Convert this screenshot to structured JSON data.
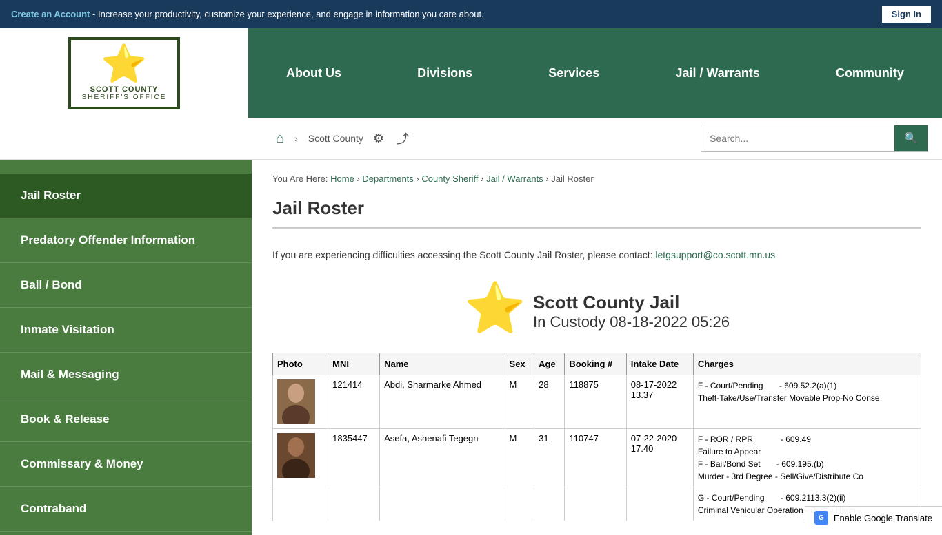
{
  "topBanner": {
    "createAccountText": "Create an Account",
    "bannerText": " - Increase your productivity, customize your experience, and engage in information you care about.",
    "signInLabel": "Sign In"
  },
  "nav": {
    "logoLine1": "SCOTT COUNTY",
    "logoLine2": "SHERIFF'S OFFICE",
    "links": [
      {
        "id": "about-us",
        "label": "About Us"
      },
      {
        "id": "divisions",
        "label": "Divisions"
      },
      {
        "id": "services",
        "label": "Services"
      },
      {
        "id": "jail-warrants",
        "label": "Jail / Warrants"
      },
      {
        "id": "community",
        "label": "Community"
      }
    ]
  },
  "secondaryNav": {
    "breadcrumbText": "Scott County",
    "searchPlaceholder": "Search..."
  },
  "sidebar": {
    "items": [
      {
        "id": "jail-roster",
        "label": "Jail Roster",
        "active": true
      },
      {
        "id": "predatory-offender",
        "label": "Predatory Offender Information"
      },
      {
        "id": "bail-bond",
        "label": "Bail / Bond"
      },
      {
        "id": "inmate-visitation",
        "label": "Inmate Visitation"
      },
      {
        "id": "mail-messaging",
        "label": "Mail & Messaging"
      },
      {
        "id": "book-release",
        "label": "Book & Release"
      },
      {
        "id": "commissary-money",
        "label": "Commissary & Money"
      },
      {
        "id": "contraband",
        "label": "Contraband"
      }
    ]
  },
  "breadcrumb": {
    "youAreHere": "You Are Here:",
    "items": [
      {
        "label": "Home",
        "href": "#"
      },
      {
        "label": "Departments",
        "href": "#"
      },
      {
        "label": "County Sheriff",
        "href": "#"
      },
      {
        "label": "Jail / Warrants",
        "href": "#"
      },
      {
        "label": "Jail Roster",
        "href": null
      }
    ]
  },
  "pageTitle": "Jail Roster",
  "infoText": "If you are experiencing difficulties accessing the Scott County Jail Roster, please contact:",
  "infoEmail": "letgsupport@co.scott.mn.us",
  "jailHeader": {
    "title": "Scott County Jail",
    "subtitle": "In Custody 08-18-2022 05:26"
  },
  "table": {
    "headers": [
      "Photo",
      "MNI",
      "Name",
      "Sex",
      "Age",
      "Booking #",
      "Intake Date",
      "Charges"
    ],
    "rows": [
      {
        "photo": "person1",
        "mni": "121414",
        "name": "Abdi, Sharmarke Ahmed",
        "sex": "M",
        "age": "28",
        "booking": "118875",
        "intakeDate": "08-17-2022\n13.37",
        "charges": [
          "F  -  Court/Pending       -  609.52.2(a)(1)",
          "Theft-Take/Use/Transfer Movable Prop-No Conse"
        ]
      },
      {
        "photo": "person2",
        "mni": "1835447",
        "name": "Asefa, Ashenafi Tegegn",
        "sex": "M",
        "age": "31",
        "booking": "110747",
        "intakeDate": "07-22-2020\n17.40",
        "charges": [
          "F  -  ROR / RPR           -  609.49",
          "Failure to Appear",
          "F  -  Bail/Bond Set       -  609.195.(b)",
          "Murder - 3rd Degree - Sell/Give/Distribute Co"
        ]
      },
      {
        "photo": "empty",
        "mni": "",
        "name": "",
        "sex": "",
        "age": "",
        "booking": "",
        "intakeDate": "",
        "charges": [
          "G  -  Court/Pending       -  609.2113.3(2)(ii)",
          "Criminal Vehicular Operation - Bodily Harm -"
        ]
      }
    ]
  },
  "translateBar": {
    "label": "Enable Google Translate",
    "iconText": "G"
  }
}
